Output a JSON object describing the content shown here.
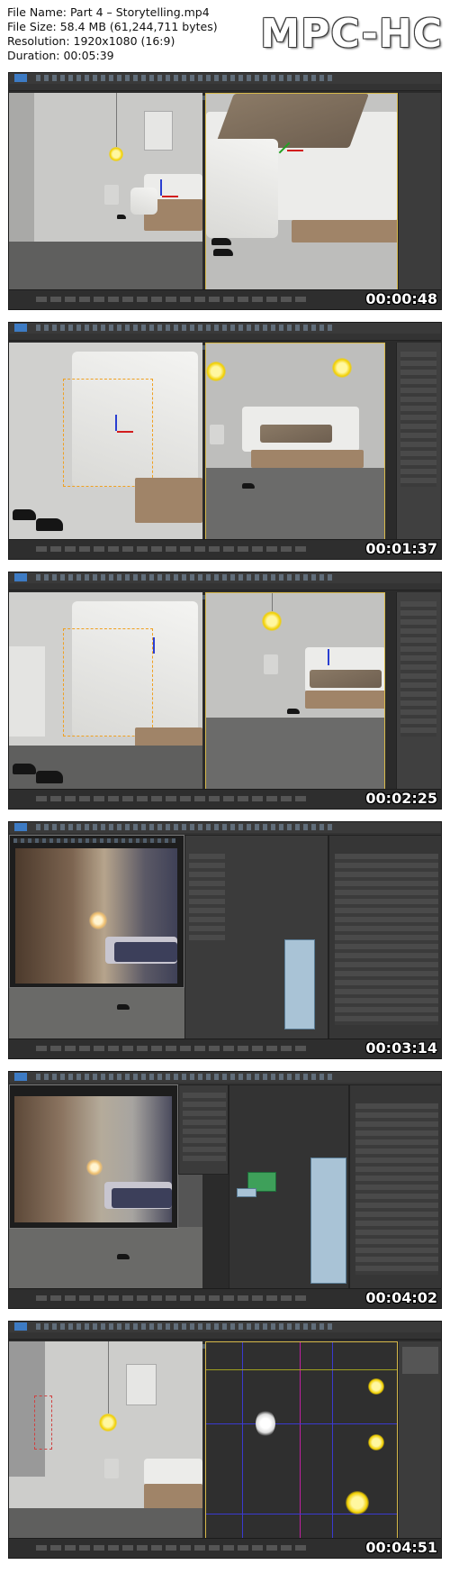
{
  "header": {
    "file_name": "File Name: Part 4 – Storytelling.mp4",
    "file_size": "File Size: 58.4 MB (61,244,711 bytes)",
    "resolution": "Resolution: 1920x1080 (16:9)",
    "duration": "Duration: 00:05:39",
    "logo": "MPC-HC"
  },
  "frames": [
    {
      "timecode": "00:00:48"
    },
    {
      "timecode": "00:01:37"
    },
    {
      "timecode": "00:02:25"
    },
    {
      "timecode": "00:03:14"
    },
    {
      "timecode": "00:04:02"
    },
    {
      "timecode": "00:04:51"
    }
  ],
  "colors": {
    "app_background": "#2b2b2b",
    "viewport_light": "#c9c9c7",
    "selection_highlight": "#d7b94a",
    "lamp_glow": "#f2d000",
    "gizmo_x": "#d21d1d",
    "gizmo_y": "#2a3ed1",
    "gizmo_z": "#22a022"
  }
}
